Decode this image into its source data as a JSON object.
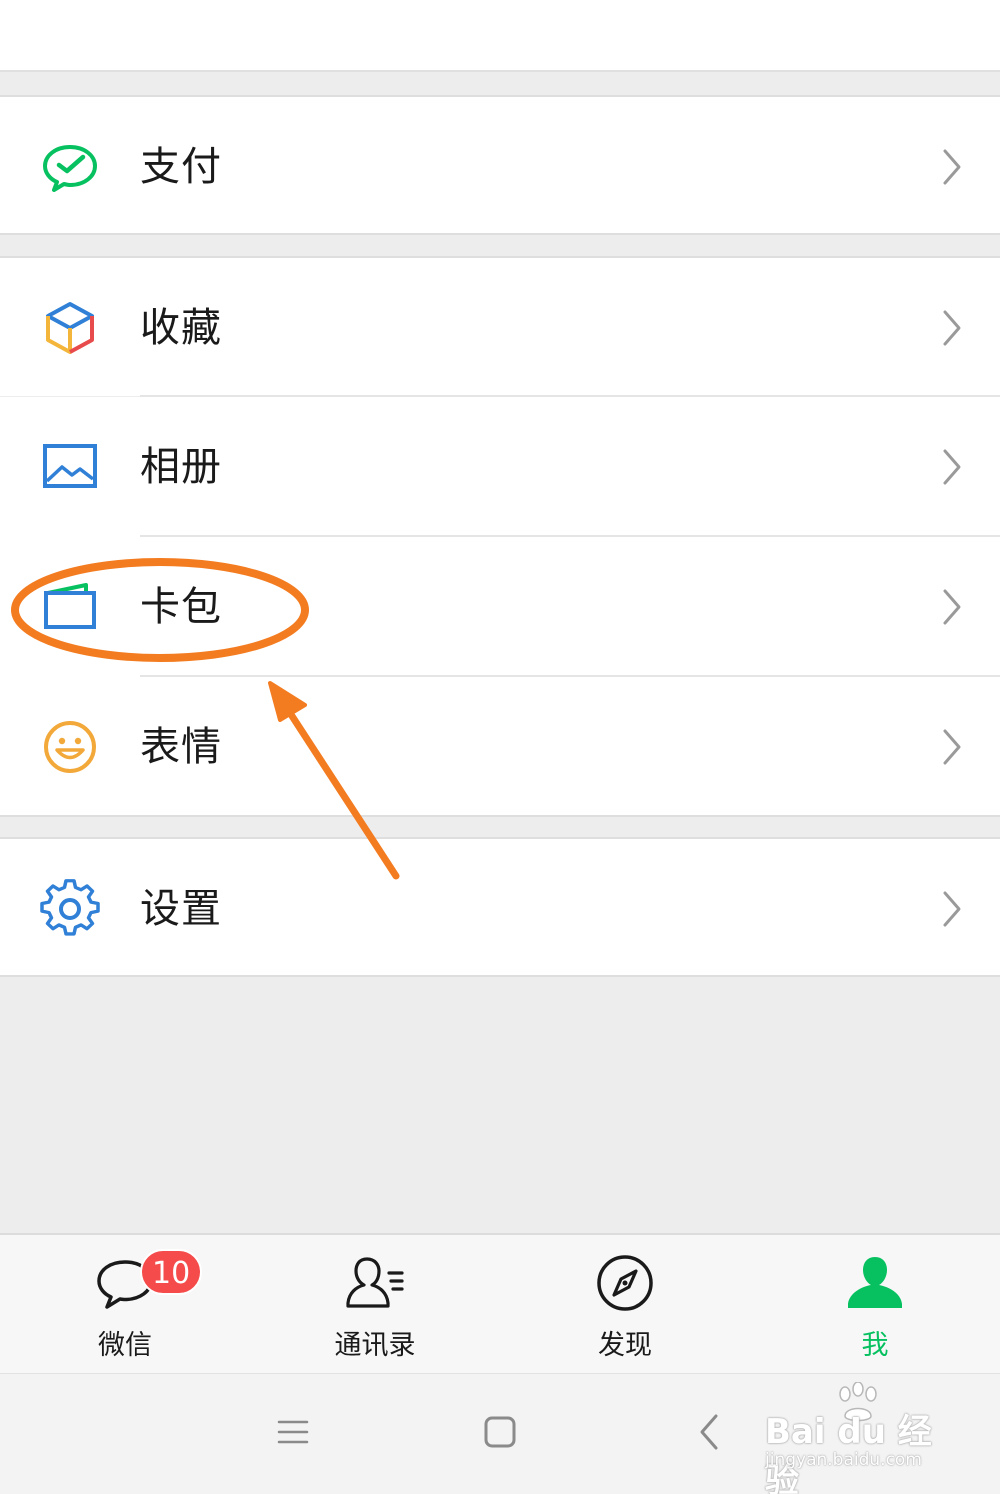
{
  "menu": {
    "pay": {
      "label": "支付",
      "icon": "wechat-pay-icon"
    },
    "favorites": {
      "label": "收藏",
      "icon": "favorites-cube-icon"
    },
    "album": {
      "label": "相册",
      "icon": "album-picture-icon"
    },
    "card_wallet": {
      "label": "卡包",
      "icon": "card-wallet-icon"
    },
    "stickers": {
      "label": "表情",
      "icon": "smiley-icon"
    },
    "settings": {
      "label": "设置",
      "icon": "gear-icon"
    }
  },
  "tabbar": {
    "chats": {
      "label": "微信",
      "badge": "10",
      "icon": "chat-bubble-icon"
    },
    "contacts": {
      "label": "通讯录",
      "icon": "contacts-icon"
    },
    "discover": {
      "label": "发现",
      "icon": "compass-icon"
    },
    "me": {
      "label": "我",
      "icon": "person-icon",
      "active": true
    }
  },
  "colors": {
    "accent_green": "#07c160",
    "annotation_orange": "#f47c20",
    "badge_red": "#f54b4b",
    "icon_blue": "#2f80d6"
  },
  "annotation": {
    "highlight_target": "card_wallet",
    "shapes": [
      "ellipse",
      "arrow"
    ]
  },
  "watermark": {
    "brand": "Bai du 经验",
    "url": "jingyan.baidu.com"
  }
}
